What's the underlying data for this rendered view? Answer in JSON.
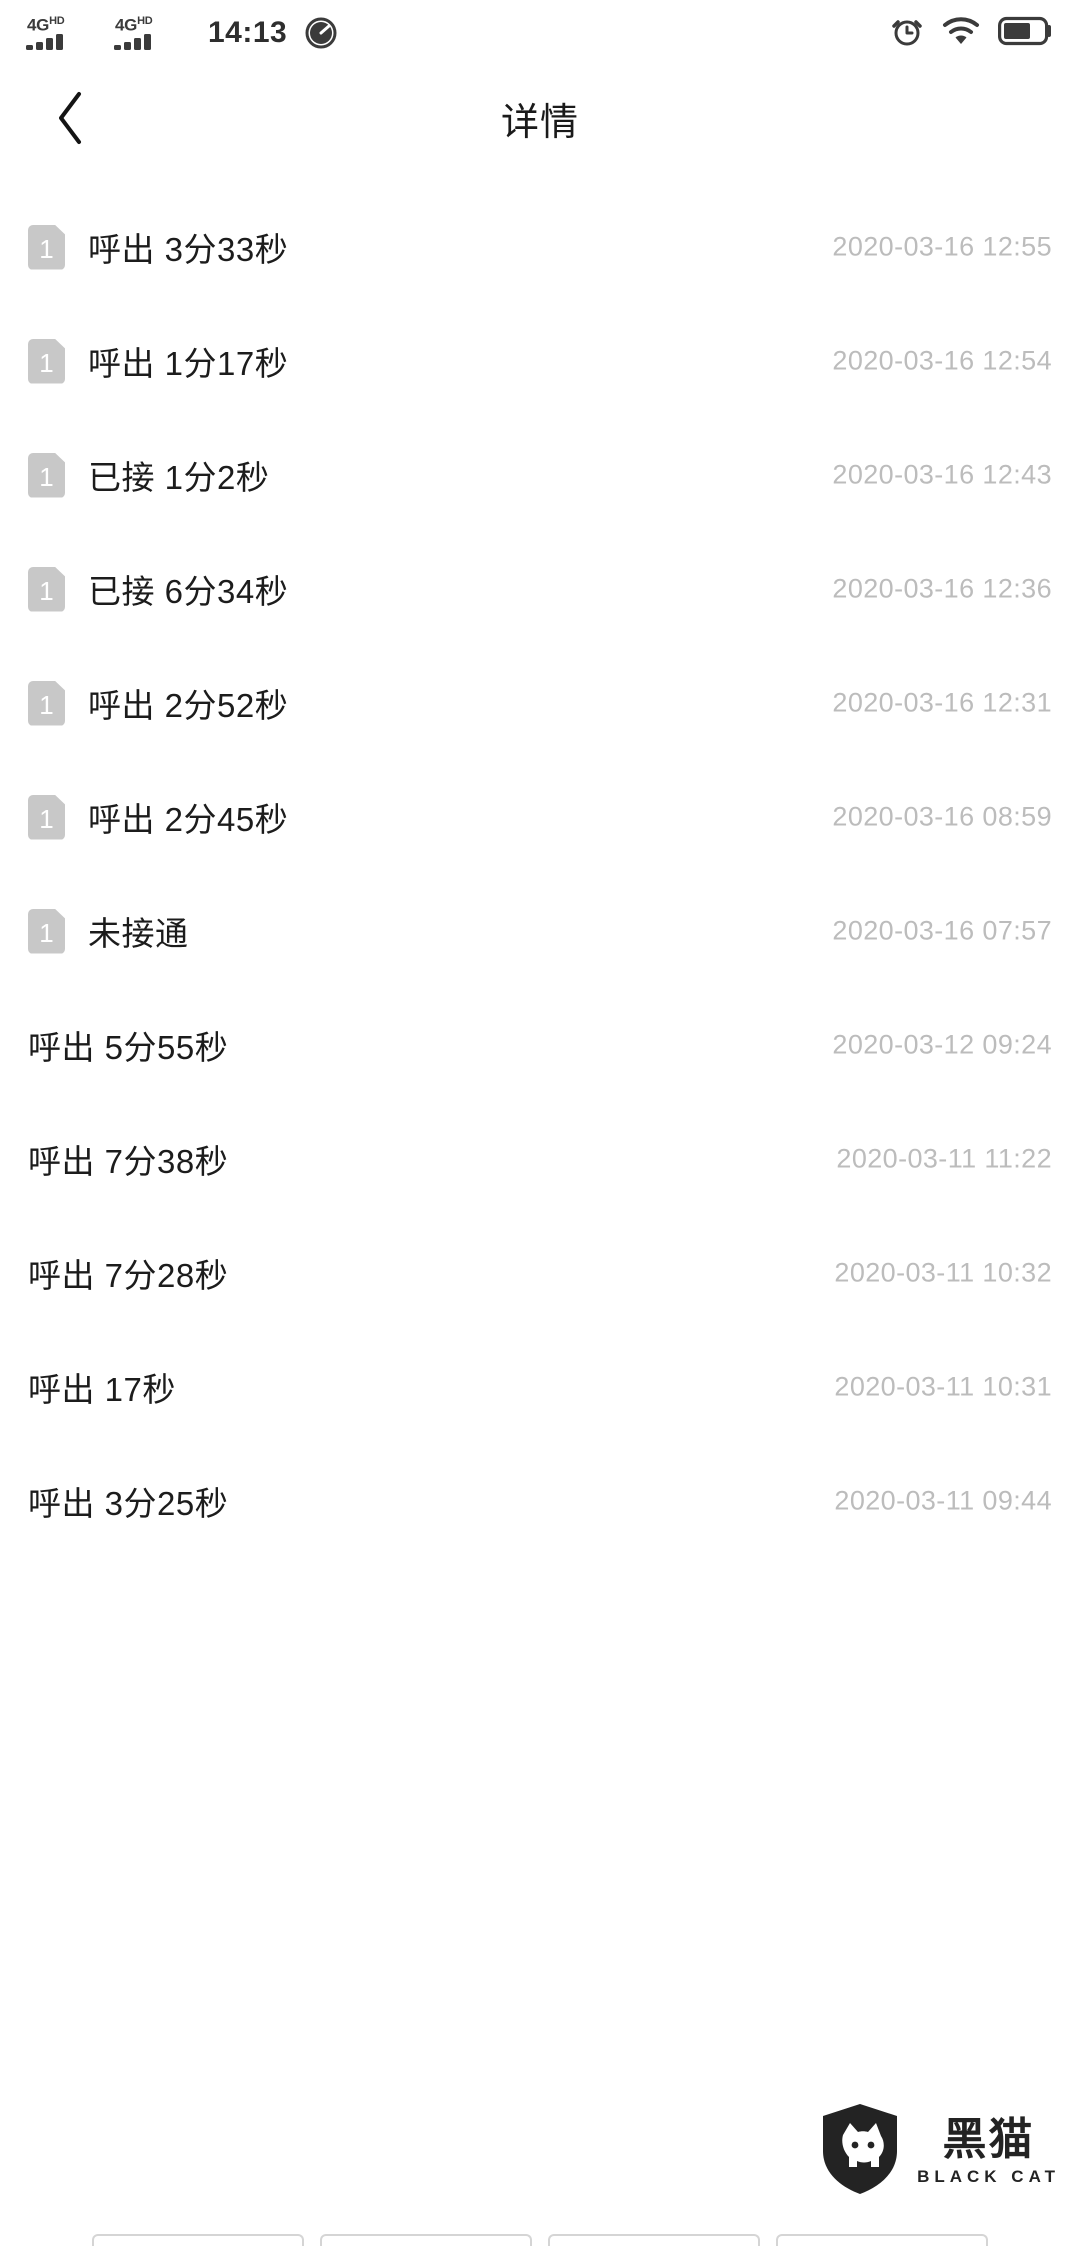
{
  "status_bar": {
    "network_label_1": "4G",
    "network_sup_1": "HD",
    "network_label_2": "4G",
    "network_sup_2": "HD",
    "time": "14:13",
    "icons": [
      "speed-dial-icon",
      "alarm-clock-icon",
      "wifi-icon",
      "battery-icon"
    ]
  },
  "header": {
    "back_label": "‹",
    "title": "详情"
  },
  "call_list": {
    "sim_badge_number": "1",
    "rows": [
      {
        "sim": "1",
        "label": "呼出 3分33秒",
        "time": "2020-03-16 12:55"
      },
      {
        "sim": "1",
        "label": "呼出 1分17秒",
        "time": "2020-03-16 12:54"
      },
      {
        "sim": "1",
        "label": "已接 1分2秒",
        "time": "2020-03-16 12:43"
      },
      {
        "sim": "1",
        "label": "已接 6分34秒",
        "time": "2020-03-16 12:36"
      },
      {
        "sim": "1",
        "label": "呼出 2分52秒",
        "time": "2020-03-16 12:31"
      },
      {
        "sim": "1",
        "label": "呼出 2分45秒",
        "time": "2020-03-16 08:59"
      },
      {
        "sim": "1",
        "label": "未接通",
        "time": "2020-03-16 07:57"
      },
      {
        "sim": "",
        "label": "呼出 5分55秒",
        "time": "2020-03-12 09:24"
      },
      {
        "sim": "",
        "label": "呼出 7分38秒",
        "time": "2020-03-11 11:22"
      },
      {
        "sim": "",
        "label": "呼出 7分28秒",
        "time": "2020-03-11 10:32"
      },
      {
        "sim": "",
        "label": "呼出 17秒",
        "time": "2020-03-11 10:31"
      },
      {
        "sim": "",
        "label": "呼出 3分25秒",
        "time": "2020-03-11 09:44"
      }
    ]
  },
  "watermark": {
    "cn": "黑猫",
    "en": "BLACK CAT"
  },
  "colors": {
    "background": "#ffffff",
    "primary_text": "#1c1c1c",
    "secondary_text": "#bcbcbc",
    "sim_badge": "#c8c8c8",
    "status_icon": "#3b3b3b"
  }
}
